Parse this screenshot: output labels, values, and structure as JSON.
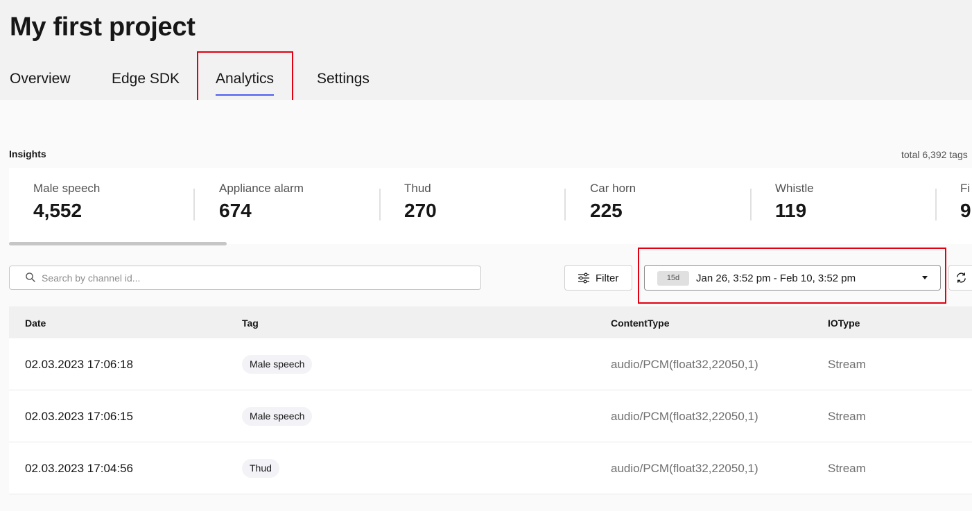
{
  "project": {
    "title": "My first project"
  },
  "tabs": [
    {
      "label": "Overview",
      "active": false
    },
    {
      "label": "Edge SDK",
      "active": false
    },
    {
      "label": "Analytics",
      "active": true
    },
    {
      "label": "Settings",
      "active": false
    }
  ],
  "insights": {
    "label": "Insights",
    "total": "total 6,392 tags",
    "cards": [
      {
        "label": "Male speech",
        "value": "4,552"
      },
      {
        "label": "Appliance alarm",
        "value": "674"
      },
      {
        "label": "Thud",
        "value": "270"
      },
      {
        "label": "Car horn",
        "value": "225"
      },
      {
        "label": "Whistle",
        "value": "119"
      },
      {
        "label": "Fi",
        "value": "9"
      }
    ]
  },
  "toolbar": {
    "search_placeholder": "Search by channel id...",
    "filter_label": "Filter",
    "range_badge": "15d",
    "range_text": "Jan 26, 3:52 pm - Feb 10, 3:52 pm"
  },
  "table": {
    "columns": [
      "Date",
      "Tag",
      "ContentType",
      "IOType"
    ],
    "rows": [
      {
        "date": "02.03.2023 17:06:18",
        "tag": "Male speech",
        "content_type": "audio/PCM(float32,22050,1)",
        "io_type": "Stream"
      },
      {
        "date": "02.03.2023 17:06:15",
        "tag": "Male speech",
        "content_type": "audio/PCM(float32,22050,1)",
        "io_type": "Stream"
      },
      {
        "date": "02.03.2023 17:04:56",
        "tag": "Thud",
        "content_type": "audio/PCM(float32,22050,1)",
        "io_type": "Stream"
      }
    ]
  },
  "colors": {
    "accent": "#4c5cf0",
    "highlight": "#e00012",
    "header_bg": "#f2f2f2"
  }
}
